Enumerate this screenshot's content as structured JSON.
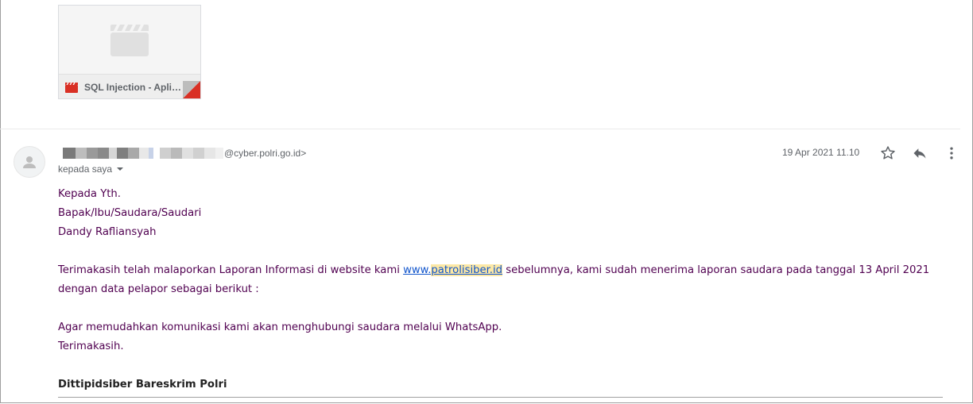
{
  "attachment": {
    "filename": "SQL Injection - Apli…",
    "preview_icon": "video-clapper-icon",
    "file_icon": "video-file-icon"
  },
  "email": {
    "sender_domain": "@cyber.polri.go.id>",
    "recipient_label": "kepada saya",
    "date": "19 Apr 2021 11.10",
    "actions": [
      "star-icon",
      "reply-icon",
      "more-vert-icon"
    ],
    "greeting": [
      "Kepada Yth.",
      "Bapak/Ibu/Saudara/Saudari",
      "Dandy Rafliansyah"
    ],
    "para1_before": "Terimakasih telah malaporkan Laporan Informasi di website kami ",
    "link_prefix": "www.",
    "link_highlight": "patrolisiber.id",
    "para1_after": " sebelumnya, kami sudah menerima laporan saudara pada tanggal 13 April 2021 dengan data pelapor sebagai berikut :",
    "para2_line1": "Agar memudahkan komunikasi kami akan menghubungi saudara melalui WhatsApp.",
    "para2_line2": "Terimakasih.",
    "signature": "Dittipidsiber Bareskrim Polri"
  },
  "colors": {
    "body_text": "#500050",
    "link": "#1155cc",
    "highlight": "#fce8a6",
    "attachment_red": "#d93025"
  }
}
